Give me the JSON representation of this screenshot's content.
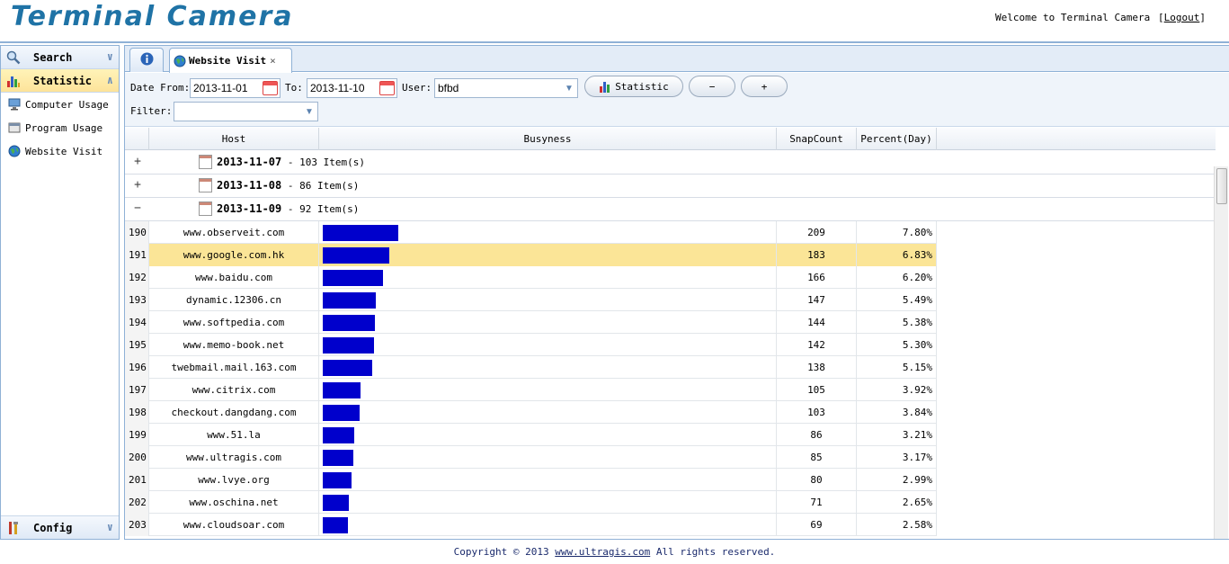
{
  "header": {
    "app_title": "Terminal Camera",
    "welcome": "Welcome to Terminal Camera",
    "logout_open": "[",
    "logout_label": "Logout",
    "logout_close": "]"
  },
  "sidebar": {
    "search_label": "Search",
    "statistic_label": "Statistic",
    "config_label": "Config",
    "items": [
      {
        "label": "Computer Usage",
        "icon": "computer-icon"
      },
      {
        "label": "Program Usage",
        "icon": "program-icon"
      },
      {
        "label": "Website Visit",
        "icon": "globe-icon"
      }
    ]
  },
  "tabs": {
    "active_label": "Website Visit",
    "close_glyph": "×"
  },
  "filters": {
    "date_from_label": "Date From:",
    "date_from_value": "2013-11-01",
    "to_label": "To:",
    "to_value": "2013-11-10",
    "user_label": "User:",
    "user_value": "bfbd",
    "filter_label": "Filter:",
    "filter_value": "",
    "statistic_button": "Statistic",
    "collapse_button": "−",
    "expand_button": "+"
  },
  "grid": {
    "columns": [
      "Host",
      "Busyness",
      "SnapCount",
      "Percent(Day)"
    ],
    "groups": [
      {
        "toggle": "+",
        "date": "2013-11-07",
        "suffix": " - 103 Item(s)"
      },
      {
        "toggle": "+",
        "date": "2013-11-08",
        "suffix": " - 86 Item(s)"
      },
      {
        "toggle": "−",
        "date": "2013-11-09",
        "suffix": " - 92 Item(s)"
      }
    ],
    "selected_row": 1,
    "bar_color": "#0000cc",
    "rows": [
      {
        "n": "190",
        "host": "www.observeit.com",
        "snap": "209",
        "pct": "7.80%"
      },
      {
        "n": "191",
        "host": "www.google.com.hk",
        "snap": "183",
        "pct": "6.83%"
      },
      {
        "n": "192",
        "host": "www.baidu.com",
        "snap": "166",
        "pct": "6.20%"
      },
      {
        "n": "193",
        "host": "dynamic.12306.cn",
        "snap": "147",
        "pct": "5.49%"
      },
      {
        "n": "194",
        "host": "www.softpedia.com",
        "snap": "144",
        "pct": "5.38%"
      },
      {
        "n": "195",
        "host": "www.memo-book.net",
        "snap": "142",
        "pct": "5.30%"
      },
      {
        "n": "196",
        "host": "twebmail.mail.163.com",
        "snap": "138",
        "pct": "5.15%"
      },
      {
        "n": "197",
        "host": "www.citrix.com",
        "snap": "105",
        "pct": "3.92%"
      },
      {
        "n": "198",
        "host": "checkout.dangdang.com",
        "snap": "103",
        "pct": "3.84%"
      },
      {
        "n": "199",
        "host": "www.51.la",
        "snap": "86",
        "pct": "3.21%"
      },
      {
        "n": "200",
        "host": "www.ultragis.com",
        "snap": "85",
        "pct": "3.17%"
      },
      {
        "n": "201",
        "host": "www.lvye.org",
        "snap": "80",
        "pct": "2.99%"
      },
      {
        "n": "202",
        "host": "www.oschina.net",
        "snap": "71",
        "pct": "2.65%"
      },
      {
        "n": "203",
        "host": "www.cloudsoar.com",
        "snap": "69",
        "pct": "2.58%"
      }
    ]
  },
  "footer": {
    "prefix": "Copyright © 2013 ",
    "link": "www.ultragis.com",
    "suffix": " All rights reserved."
  },
  "colors": {
    "accent": "#1f73a6",
    "border": "#8fb1d6",
    "selected_row": "#fbe597"
  }
}
